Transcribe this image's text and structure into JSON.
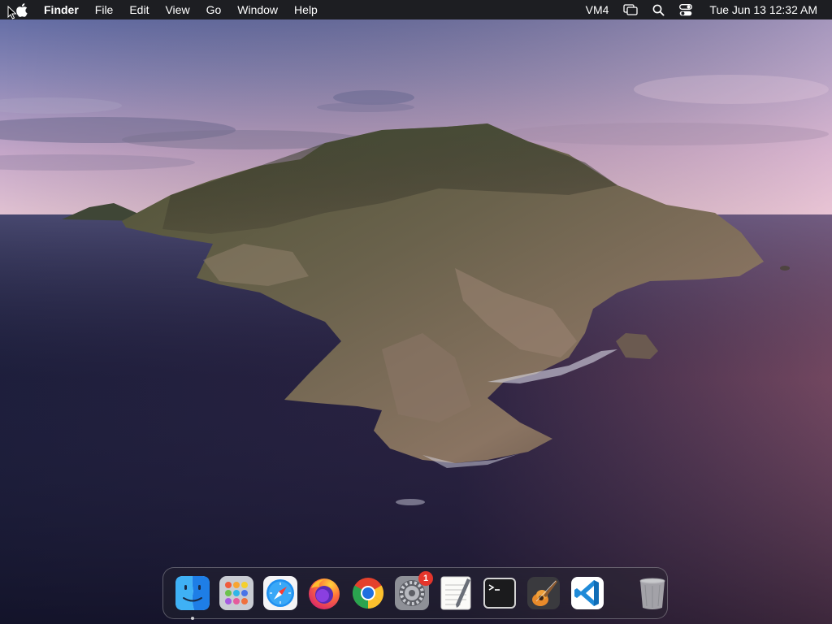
{
  "menubar": {
    "app_name": "Finder",
    "menus": [
      "File",
      "Edit",
      "View",
      "Go",
      "Window",
      "Help"
    ],
    "status": {
      "vm_label": "VM4",
      "clock": "Tue Jun 13  12:32 AM",
      "icons": [
        "screen-mirroring-icon",
        "spotlight-search-icon",
        "control-center-icon"
      ]
    }
  },
  "dock": {
    "apps": [
      {
        "name": "Finder",
        "icon": "finder-icon",
        "running": true
      },
      {
        "name": "Launchpad",
        "icon": "launchpad-icon",
        "running": false
      },
      {
        "name": "Safari",
        "icon": "safari-icon",
        "running": false
      },
      {
        "name": "Firefox",
        "icon": "firefox-icon",
        "running": false
      },
      {
        "name": "Google Chrome",
        "icon": "chrome-icon",
        "running": false
      },
      {
        "name": "System Preferences",
        "icon": "system-preferences-icon",
        "running": false,
        "badge": "1"
      },
      {
        "name": "TextEdit",
        "icon": "textedit-icon",
        "running": false
      },
      {
        "name": "Terminal",
        "icon": "terminal-icon",
        "running": false
      },
      {
        "name": "GarageBand",
        "icon": "garageband-icon",
        "running": false
      },
      {
        "name": "Visual Studio Code",
        "icon": "vscode-icon",
        "running": false
      }
    ],
    "trash": {
      "name": "Trash",
      "icon": "trash-icon"
    }
  },
  "colors": {
    "menubar_bg": "#1d1e22",
    "badge": "#e5352b",
    "sky_top": "#5b6aa0",
    "sky_horizon": "#d9b8cf",
    "sea": "#1c1d3a"
  }
}
